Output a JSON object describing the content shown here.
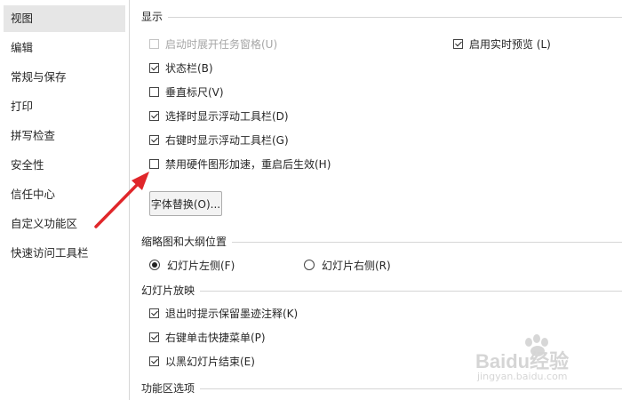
{
  "sidebar": {
    "items": [
      {
        "label": "视图",
        "selected": true
      },
      {
        "label": "编辑"
      },
      {
        "label": "常规与保存"
      },
      {
        "label": "打印"
      },
      {
        "label": "拼写检查"
      },
      {
        "label": "安全性"
      },
      {
        "label": "信任中心"
      },
      {
        "label": "自定义功能区"
      },
      {
        "label": "快速访问工具栏"
      }
    ]
  },
  "display": {
    "title": "显示",
    "startup_task_pane": {
      "label": "启动时展开任务窗格(U)",
      "checked": false,
      "disabled": true
    },
    "live_preview": {
      "label": "启用实时预览 (L)",
      "checked": true
    },
    "status_bar": {
      "label": "状态栏(B)",
      "checked": true
    },
    "vertical_ruler": {
      "label": "垂直标尺(V)",
      "checked": false
    },
    "floating_toolbar_select": {
      "label": "选择时显示浮动工具栏(D)",
      "checked": true
    },
    "floating_toolbar_rightclick": {
      "label": "右键时显示浮动工具栏(G)",
      "checked": true
    },
    "disable_hw_accel": {
      "label": "禁用硬件图形加速，重启后生效(H)",
      "checked": false
    },
    "font_replace_button": "字体替换(O)..."
  },
  "thumbnail": {
    "title": "缩略图和大纲位置",
    "left": {
      "label": "幻灯片左侧(F)",
      "checked": true
    },
    "right": {
      "label": "幻灯片右侧(R)",
      "checked": false
    }
  },
  "slideshow": {
    "title": "幻灯片放映",
    "ink_prompt": {
      "label": "退出时提示保留墨迹注释(K)",
      "checked": true
    },
    "right_click_menu": {
      "label": "右键单击快捷菜单(P)",
      "checked": true
    },
    "end_black": {
      "label": "以黑幻灯片结束(E)",
      "checked": true
    }
  },
  "ribbon": {
    "title": "功能区选项"
  },
  "watermark": {
    "brand": "Baidu经验",
    "url": "jingyan.baidu.com"
  },
  "colors": {
    "arrow": "#e0262a",
    "selected_bg": "#e6e6e6"
  }
}
